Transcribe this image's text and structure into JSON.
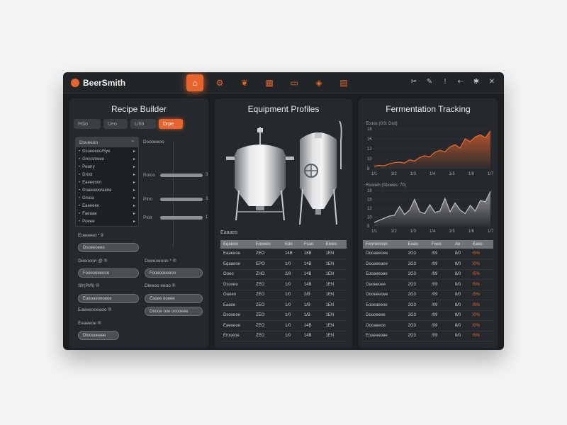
{
  "brand": {
    "name": "BeerSmith"
  },
  "nav": [
    "home",
    "gear",
    "hop",
    "calendar",
    "inventory",
    "check",
    "calculator"
  ],
  "tools": [
    "cut",
    "edit",
    "alert",
    "share",
    "settings",
    "close"
  ],
  "colors": {
    "accent": "#e8642c",
    "background": "#1c1f22",
    "panel": "#25292d"
  },
  "recipe": {
    "title": "Recipe Builder",
    "tabs": [
      "Ftbo",
      "Ueo",
      "Lihb",
      "Drpe"
    ],
    "list_header": "Dsueeoo",
    "list_items": [
      "Dsueeeoo/Sye",
      "Grossmeeo",
      "Pearry",
      "Drost",
      "Eaeeeoon",
      "Draeeeoo/aene",
      "Grsoa",
      "Eaeeeeo",
      "Faeaaa",
      "Poeee"
    ],
    "slider_heading": "Dsooeeoo",
    "sliders": [
      {
        "label": "Roloo",
        "value": "3",
        "level": 1.0
      },
      {
        "label": "Pltro",
        "value": "3",
        "level": 1.0
      },
      {
        "label": "Plolr",
        "value": "1",
        "level": 1.0
      }
    ],
    "fields": [
      {
        "label": "Eoeeeed * 9",
        "value": "Dsoeeoeeo"
      },
      {
        "label": "Deeooon @ ®",
        "value": "Fooeooeeooo"
      },
      {
        "label": "Deeeoeoon * ®",
        "value": "Fooeooeeeoo"
      },
      {
        "label": "Sfr(Pl/fi) ®",
        "value": "Eueoueonoeoe"
      },
      {
        "label": "Dieeoo eeoo ®",
        "value": "Deooe ooe ooooeee"
      },
      {
        "label": "Eaeeeooeaoo ®",
        "value": "Eaoee ooeee"
      },
      {
        "label": "Eeaeeoe ®",
        "value": "Dlooooeeee"
      }
    ]
  },
  "equipment": {
    "title": "Equipment Profiles",
    "section_label": "Eaaaeo",
    "columns": [
      "Eqaeoo",
      "Eooeeo",
      "Edo",
      "Fsao",
      "Eleeo"
    ],
    "rows": [
      [
        "Eaaeeoe",
        "ZEO",
        "14B",
        "16B",
        "1EN"
      ],
      [
        "Eqaaeoe",
        "EPO",
        "1/0",
        "14B",
        "1EN"
      ],
      [
        "Ooeo",
        "ZHO",
        "2/8",
        "14B",
        "1EN"
      ],
      [
        "Dsooeo",
        "ZEO",
        "1/0",
        "14B",
        "1EN"
      ],
      [
        "Oaoeo",
        "ZEO",
        "1/0",
        "2/B",
        "1EN"
      ],
      [
        "Eaaoe",
        "ZEO",
        "1/0",
        "1/B",
        "1EN"
      ],
      [
        "Dsooeoe",
        "ZEO",
        "1/0",
        "1/B",
        "1EN"
      ],
      [
        "Eaeoeoe",
        "ZEO",
        "1/0",
        "14B",
        "1EN"
      ],
      [
        "Erooeoe",
        "ZEO",
        "1/0",
        "14B",
        "1EN"
      ]
    ]
  },
  "fermentation": {
    "title": "Fermentation Tracking",
    "chart1_label": "Ecoos (0/3: Dsd)",
    "chart2_label": "Rsooeh (Sboees: 70)",
    "columns": [
      "Fermenoon",
      "Eoao",
      "Fouo",
      "Ae",
      "Eaeo"
    ],
    "rows": [
      [
        "Oooaeeoee",
        "2G3",
        "/09",
        "8/0",
        "/5%"
      ],
      [
        "Dooaeeaee",
        "2G3",
        "/09",
        "8/0",
        "/0%"
      ],
      [
        "Eooaeeoee",
        "2G3",
        "/09",
        "8/0",
        "/5%"
      ],
      [
        "Oaoeeoee",
        "2G3",
        "/09",
        "8/0",
        "/5%"
      ],
      [
        "Oooeeeoee",
        "2G3",
        "/09",
        "8/0",
        "/5%"
      ],
      [
        "Eooeaeeoe",
        "2G3",
        "/09",
        "8/0",
        "/5%"
      ],
      [
        "Doooeeee",
        "2G3",
        "/09",
        "8/0",
        "/0%"
      ],
      [
        "Oooaeeoe",
        "2G3",
        "/09",
        "8/0",
        "/0%"
      ],
      [
        "Eoaeeeoee",
        "2G3",
        "/09",
        "8/0",
        "/5%"
      ]
    ]
  },
  "chart_data": [
    {
      "type": "area",
      "title": "Ecoos (0/3: Dsd)",
      "categories": [
        "1/1",
        "1/2",
        "1/3",
        "1/4",
        "1/5",
        "1/6",
        "1/7"
      ],
      "y_ticks": [
        "18",
        "15",
        "12",
        "10",
        "8"
      ],
      "ylim": [
        8,
        18
      ],
      "x": [
        0,
        1,
        2,
        3,
        4,
        5,
        6,
        7,
        8,
        9,
        10,
        11,
        12,
        13,
        14,
        15,
        16,
        17,
        18,
        19,
        20,
        21,
        22,
        23
      ],
      "values": [
        8.6,
        8.8,
        8.7,
        9.2,
        9.5,
        9.6,
        9.4,
        10.2,
        9.9,
        10.8,
        11.2,
        11.0,
        12.1,
        12.6,
        12.2,
        13.5,
        14.0,
        13.2,
        15.5,
        14.8,
        16.0,
        16.5,
        15.8,
        17.5
      ],
      "color": "#e8642c",
      "grid": true
    },
    {
      "type": "area",
      "title": "Rsooeh (Sboees: 70)",
      "categories": [
        "1/1",
        "1/2",
        "1/3",
        "1/4",
        "1/5",
        "1/6",
        "1/7"
      ],
      "y_ticks": [
        "18",
        "15",
        "12",
        "10",
        "8"
      ],
      "ylim": [
        8,
        18
      ],
      "x": [
        0,
        1,
        2,
        3,
        4,
        5,
        6,
        7,
        8,
        9,
        10,
        11,
        12,
        13,
        14,
        15,
        16,
        17,
        18,
        19,
        20,
        21,
        22,
        23
      ],
      "values": [
        9.0,
        9.6,
        10.2,
        10.8,
        11.0,
        13.5,
        11.2,
        12.5,
        15.5,
        12.0,
        11.5,
        14.0,
        11.8,
        12.2,
        15.8,
        12.0,
        14.5,
        12.5,
        11.5,
        13.8,
        12.2,
        15.2,
        14.8,
        17.8
      ],
      "color": "#b8b8b8",
      "grid": true
    }
  ]
}
